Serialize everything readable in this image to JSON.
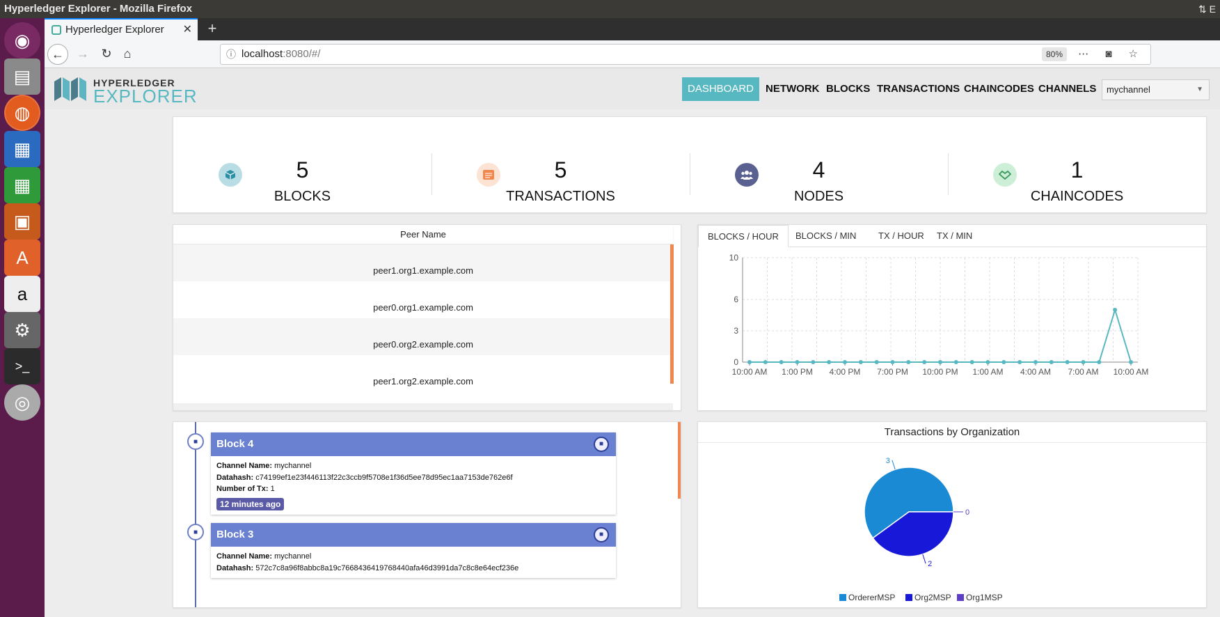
{
  "window": {
    "title": "Hyperledger Explorer - Mozilla Firefox",
    "tray": "⇅ E"
  },
  "browser": {
    "tab_title": "Hyperledger Explorer",
    "url_host": "localhost",
    "url_rest": ":8080/#/",
    "zoom": "80%"
  },
  "app": {
    "logo_top": "HYPERLEDGER",
    "logo_bottom": "EXPLORER",
    "nav": [
      "DASHBOARD",
      "NETWORK",
      "BLOCKS",
      "TRANSACTIONS",
      "CHAINCODES",
      "CHANNELS"
    ],
    "active_nav": "DASHBOARD",
    "channel": "mychannel"
  },
  "stats": [
    {
      "value": "5",
      "label": "BLOCKS",
      "icon": "cube-icon",
      "color": "#2b8fa6",
      "bg": "#b9dde5"
    },
    {
      "value": "5",
      "label": "TRANSACTIONS",
      "icon": "list-icon",
      "color": "#f0874f",
      "bg": "#fde3d4"
    },
    {
      "value": "4",
      "label": "NODES",
      "icon": "users-icon",
      "color": "#ffffff",
      "bg": "#5a6190"
    },
    {
      "value": "1",
      "label": "CHAINCODES",
      "icon": "handshake-icon",
      "color": "#3c9a5f",
      "bg": "#cdeed7"
    }
  ],
  "peers": {
    "header": "Peer Name",
    "rows": [
      "peer1.org1.example.com",
      "peer0.org1.example.com",
      "peer0.org2.example.com",
      "peer1.org2.example.com"
    ]
  },
  "chart_tabs": [
    "BLOCKS / HOUR",
    "BLOCKS / MIN",
    "TX / HOUR",
    "TX / MIN"
  ],
  "chart_data": [
    {
      "type": "line",
      "x_tick_labels": [
        "10:00 AM",
        "1:00 PM",
        "4:00 PM",
        "7:00 PM",
        "10:00 PM",
        "1:00 AM",
        "4:00 AM",
        "7:00 AM",
        "10:00 AM"
      ],
      "y_ticks": [
        0,
        3,
        6,
        10
      ],
      "ylim": [
        0,
        10
      ],
      "grid": true,
      "values": [
        0,
        0,
        0,
        0,
        0,
        0,
        0,
        0,
        0,
        0,
        0,
        0,
        0,
        0,
        0,
        0,
        0,
        0,
        0,
        0,
        0,
        0,
        0,
        5,
        0
      ],
      "color": "#57b8c2"
    },
    {
      "type": "pie",
      "title": "Transactions by Organization",
      "slices": [
        {
          "name": "OrdererMSP",
          "value": 3,
          "color": "#1a8ad4"
        },
        {
          "name": "Org2MSP",
          "value": 2,
          "color": "#1818d8"
        },
        {
          "name": "Org1MSP",
          "value": 0,
          "color": "#5c3fc4"
        }
      ],
      "legend": "bottom"
    }
  ],
  "blocks": [
    {
      "title": "Block 4",
      "channel_label": "Channel Name:",
      "channel": "mychannel",
      "datahash_label": "Datahash:",
      "datahash": "c74199ef1e23f446113f22c3ccb9f5708e1f36d5ee78d95ec1aa7153de762e6f",
      "tx_label": "Number of Tx:",
      "tx": "1",
      "age": "12 minutes ago"
    },
    {
      "title": "Block 3",
      "channel_label": "Channel Name:",
      "channel": "mychannel",
      "datahash_label": "Datahash:",
      "datahash": "572c7c8a96f8abbc8a19c7668436419768440afa46d3991da7c8c8e64ecf236e"
    }
  ]
}
